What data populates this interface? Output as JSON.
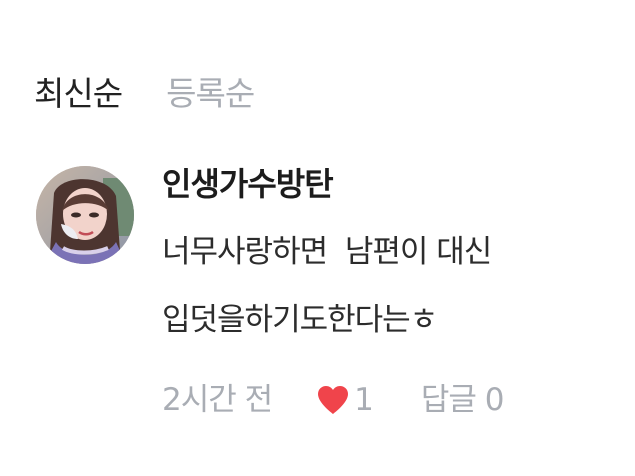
{
  "sort_tabs": {
    "latest": "최신순",
    "registered": "등록순"
  },
  "comment": {
    "username": "인생가수방탄",
    "text_lines": [
      "너무사랑하면  남편이 대신",
      "입덧을하기도한다는ㅎ"
    ],
    "time": "2시간 전",
    "like_count": "1",
    "reply_label": "답글",
    "reply_count": "0"
  },
  "colors": {
    "active_tab": "#222222",
    "inactive_text": "#a9adb4",
    "heart": "#f0444b"
  },
  "icons": {
    "like": "heart-icon"
  }
}
